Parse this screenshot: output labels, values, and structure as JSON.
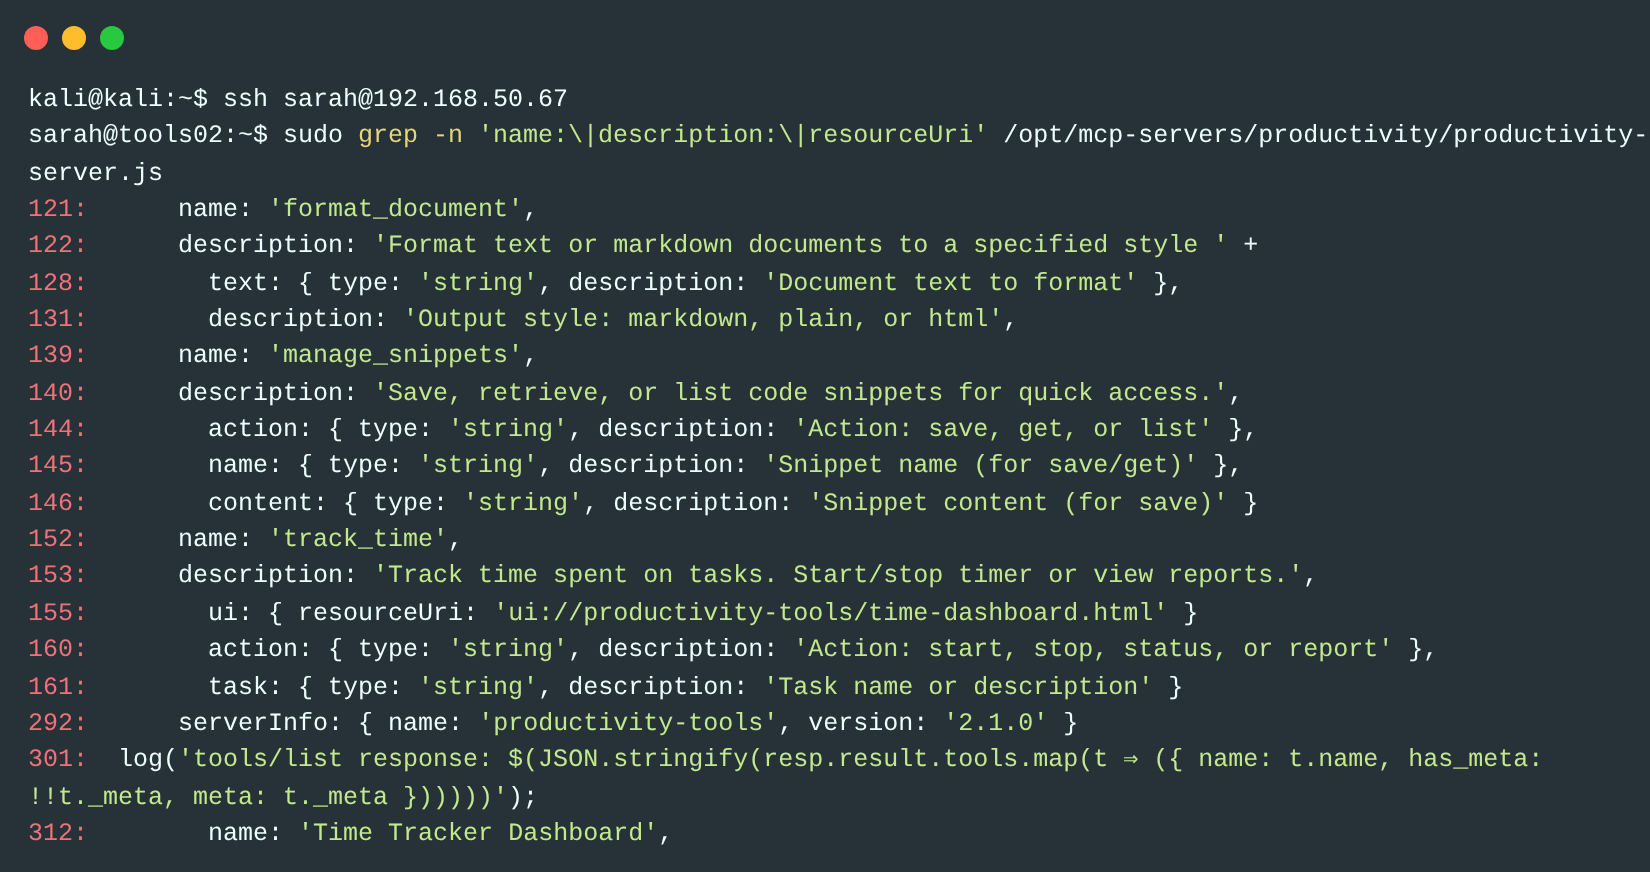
{
  "window": {
    "controls": [
      {
        "color": "#ff5f56"
      },
      {
        "color": "#ffbd2e"
      },
      {
        "color": "#27c93f"
      }
    ]
  },
  "lines": [
    {
      "kind": "command",
      "segments": [
        {
          "kind": "plain",
          "text": "kali@kali:~$ ssh sarah@192.168.50.67"
        }
      ]
    },
    {
      "kind": "command",
      "segments": [
        {
          "kind": "plain",
          "text": "sarah@tools02:~$ sudo "
        },
        {
          "kind": "keyword",
          "text": "grep -n "
        },
        {
          "kind": "string",
          "text": "'name:\\|description:\\|resourceUri'"
        },
        {
          "kind": "plain",
          "text": " /opt/mcp-servers/productivity/productivity-"
        }
      ]
    },
    {
      "kind": "command",
      "segments": [
        {
          "kind": "plain",
          "text": "server.js"
        }
      ]
    },
    {
      "kind": "match",
      "number": "121:",
      "segments": [
        {
          "kind": "plain",
          "text": "      name: "
        },
        {
          "kind": "string",
          "text": "'format_document'"
        },
        {
          "kind": "plain",
          "text": ","
        }
      ]
    },
    {
      "kind": "match",
      "number": "122:",
      "segments": [
        {
          "kind": "plain",
          "text": "      description: "
        },
        {
          "kind": "string",
          "text": "'Format text or markdown documents to a specified style '"
        },
        {
          "kind": "plain",
          "text": " +"
        }
      ]
    },
    {
      "kind": "match",
      "number": "128:",
      "segments": [
        {
          "kind": "plain",
          "text": "        text: { type: "
        },
        {
          "kind": "string",
          "text": "'string'"
        },
        {
          "kind": "plain",
          "text": ", description: "
        },
        {
          "kind": "string",
          "text": "'Document text to format'"
        },
        {
          "kind": "plain",
          "text": " },"
        }
      ]
    },
    {
      "kind": "match",
      "number": "131:",
      "segments": [
        {
          "kind": "plain",
          "text": "        description: "
        },
        {
          "kind": "string",
          "text": "'Output style: markdown, plain, or html'"
        },
        {
          "kind": "plain",
          "text": ","
        }
      ]
    },
    {
      "kind": "match",
      "number": "139:",
      "segments": [
        {
          "kind": "plain",
          "text": "      name: "
        },
        {
          "kind": "string",
          "text": "'manage_snippets'"
        },
        {
          "kind": "plain",
          "text": ","
        }
      ]
    },
    {
      "kind": "match",
      "number": "140:",
      "segments": [
        {
          "kind": "plain",
          "text": "      description: "
        },
        {
          "kind": "string",
          "text": "'Save, retrieve, or list code snippets for quick access.'"
        },
        {
          "kind": "plain",
          "text": ","
        }
      ]
    },
    {
      "kind": "match",
      "number": "144:",
      "segments": [
        {
          "kind": "plain",
          "text": "        action: { type: "
        },
        {
          "kind": "string",
          "text": "'string'"
        },
        {
          "kind": "plain",
          "text": ", description: "
        },
        {
          "kind": "string",
          "text": "'Action: save, get, or list'"
        },
        {
          "kind": "plain",
          "text": " },"
        }
      ]
    },
    {
      "kind": "match",
      "number": "145:",
      "segments": [
        {
          "kind": "plain",
          "text": "        name: { type: "
        },
        {
          "kind": "string",
          "text": "'string'"
        },
        {
          "kind": "plain",
          "text": ", description: "
        },
        {
          "kind": "string",
          "text": "'Snippet name (for save/get)'"
        },
        {
          "kind": "plain",
          "text": " },"
        }
      ]
    },
    {
      "kind": "match",
      "number": "146:",
      "segments": [
        {
          "kind": "plain",
          "text": "        content: { type: "
        },
        {
          "kind": "string",
          "text": "'string'"
        },
        {
          "kind": "plain",
          "text": ", description: "
        },
        {
          "kind": "string",
          "text": "'Snippet content (for save)'"
        },
        {
          "kind": "plain",
          "text": " }"
        }
      ]
    },
    {
      "kind": "match",
      "number": "152:",
      "segments": [
        {
          "kind": "plain",
          "text": "      name: "
        },
        {
          "kind": "string",
          "text": "'track_time'"
        },
        {
          "kind": "plain",
          "text": ","
        }
      ]
    },
    {
      "kind": "match",
      "number": "153:",
      "segments": [
        {
          "kind": "plain",
          "text": "      description: "
        },
        {
          "kind": "string",
          "text": "'Track time spent on tasks. Start/stop timer or view reports.'"
        },
        {
          "kind": "plain",
          "text": ","
        }
      ]
    },
    {
      "kind": "match",
      "number": "155:",
      "segments": [
        {
          "kind": "plain",
          "text": "        ui: { resourceUri: "
        },
        {
          "kind": "string",
          "text": "'ui://productivity-tools/time-dashboard.html'"
        },
        {
          "kind": "plain",
          "text": " }"
        }
      ]
    },
    {
      "kind": "match",
      "number": "160:",
      "segments": [
        {
          "kind": "plain",
          "text": "        action: { type: "
        },
        {
          "kind": "string",
          "text": "'string'"
        },
        {
          "kind": "plain",
          "text": ", description: "
        },
        {
          "kind": "string",
          "text": "'Action: start, stop, status, or report'"
        },
        {
          "kind": "plain",
          "text": " },"
        }
      ]
    },
    {
      "kind": "match",
      "number": "161:",
      "segments": [
        {
          "kind": "plain",
          "text": "        task: { type: "
        },
        {
          "kind": "string",
          "text": "'string'"
        },
        {
          "kind": "plain",
          "text": ", description: "
        },
        {
          "kind": "string",
          "text": "'Task name or description'"
        },
        {
          "kind": "plain",
          "text": " }"
        }
      ]
    },
    {
      "kind": "match",
      "number": "292:",
      "segments": [
        {
          "kind": "plain",
          "text": "      serverInfo: { name: "
        },
        {
          "kind": "string",
          "text": "'productivity-tools'"
        },
        {
          "kind": "plain",
          "text": ", version: "
        },
        {
          "kind": "string",
          "text": "'2.1.0'"
        },
        {
          "kind": "plain",
          "text": " }"
        }
      ]
    },
    {
      "kind": "match",
      "number": "301:",
      "segments": [
        {
          "kind": "plain",
          "text": "  log("
        },
        {
          "kind": "string",
          "text": "'tools/list response: $(JSON.stringify(resp.result.tools.map(t ⇒ ({ name: t.name, has_meta:"
        }
      ]
    },
    {
      "kind": "command",
      "segments": [
        {
          "kind": "string",
          "text": "!!t._meta, meta: t._meta })))))'"
        },
        {
          "kind": "plain",
          "text": ");"
        }
      ]
    },
    {
      "kind": "match",
      "number": "312:",
      "segments": [
        {
          "kind": "plain",
          "text": "        name: "
        },
        {
          "kind": "string",
          "text": "'Time Tracker Dashboard'"
        },
        {
          "kind": "plain",
          "text": ","
        }
      ]
    }
  ]
}
